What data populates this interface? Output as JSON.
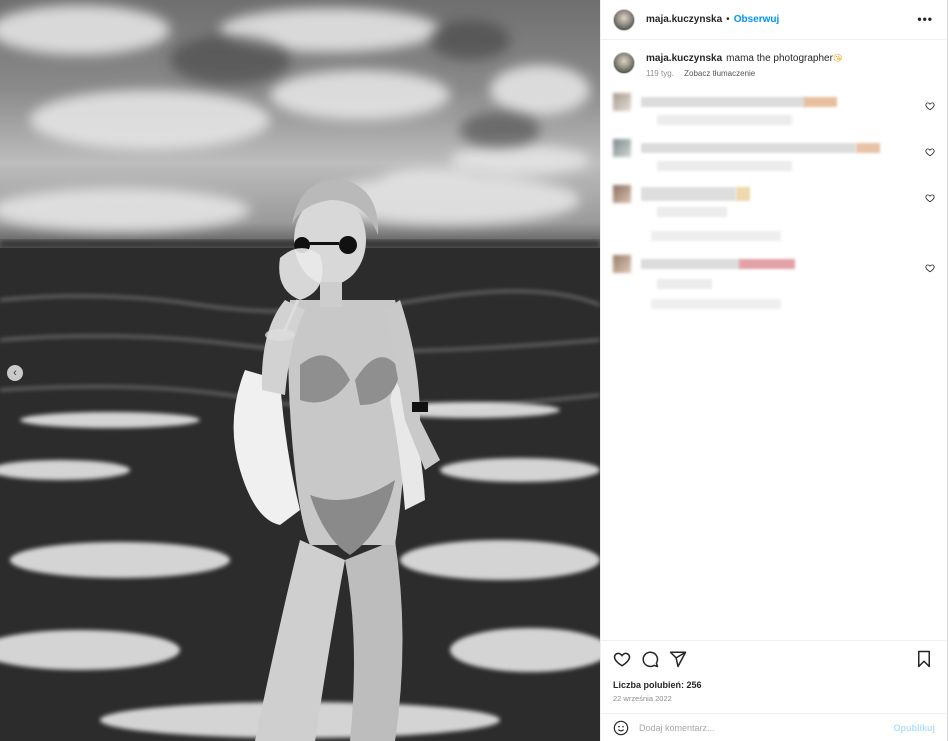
{
  "header": {
    "username": "maja.kuczynska",
    "separator": "•",
    "follow_label": "Obserwuj",
    "more_label": "•••"
  },
  "caption": {
    "username": "maja.kuczynska",
    "text": "mama the photographer",
    "emoji": "😘",
    "age": "119 tyg.",
    "translate_label": "Zobacz tłumaczenie"
  },
  "actions": {
    "likes_text": "Liczba polubień: 256",
    "date_text": "22 września 2022"
  },
  "comment_input": {
    "placeholder": "Dodaj komentarz...",
    "publish_label": "Opublikuj"
  },
  "photo": {
    "prev_arrow": "‹"
  },
  "colors": {
    "accent": "#0095f6",
    "publish_disabled": "#b2dffc",
    "muted": "#8e8e8e"
  }
}
